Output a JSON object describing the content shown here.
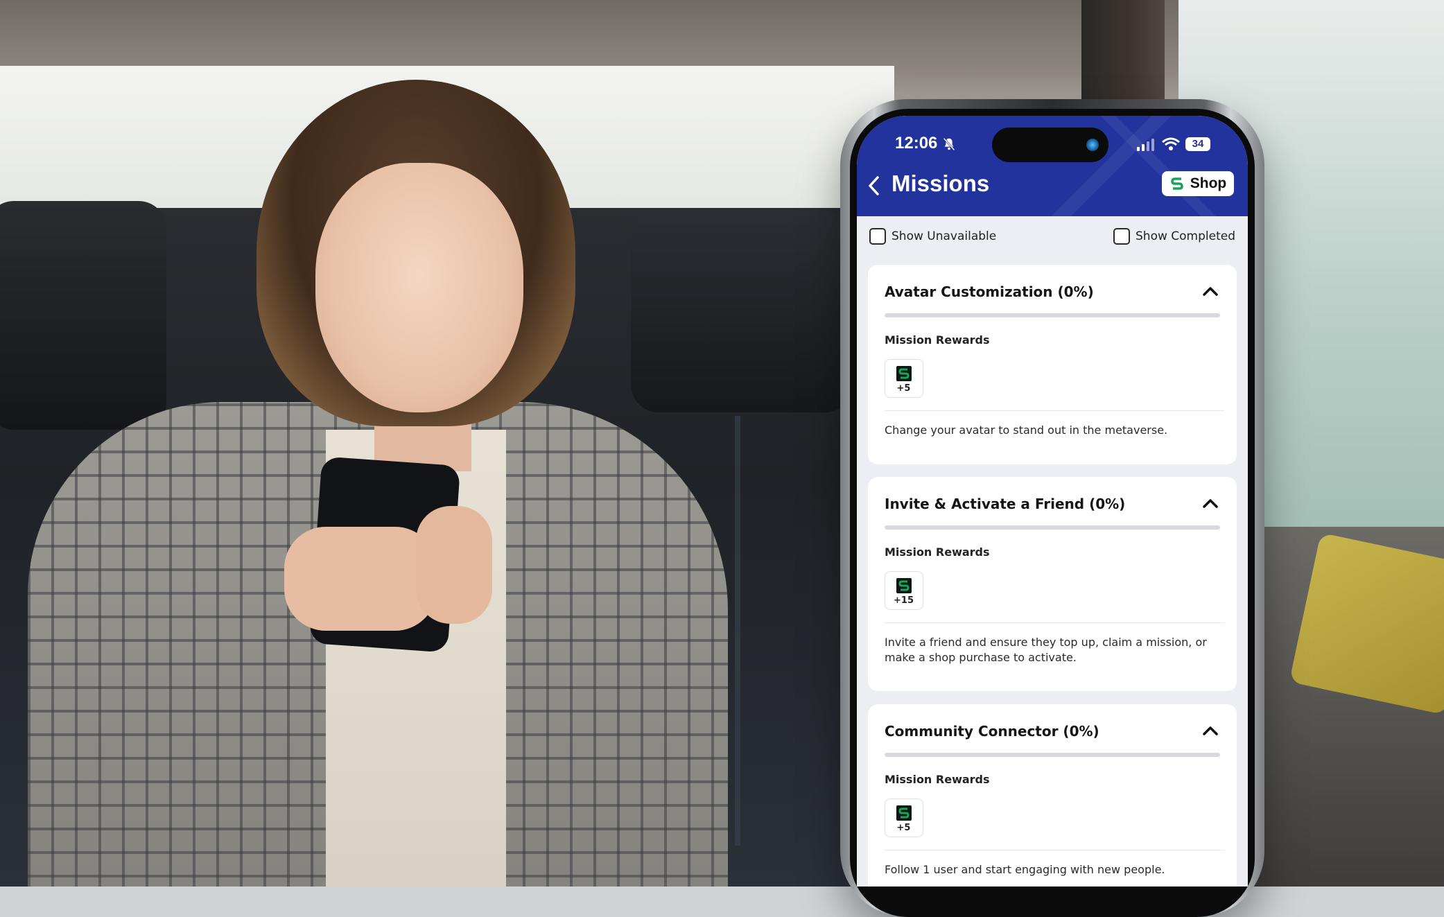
{
  "status_bar": {
    "time": "12:06",
    "battery": "34"
  },
  "header": {
    "title": "Missions",
    "shop_label": "Shop"
  },
  "filters": {
    "show_unavailable": "Show Unavailable",
    "show_completed": "Show Completed"
  },
  "missions": [
    {
      "title": "Avatar Customization (0%)",
      "progress": 0,
      "rewards_label": "Mission Rewards",
      "reward_amount": "+5",
      "description": "Change your avatar to stand out in the metaverse."
    },
    {
      "title": "Invite & Activate a Friend (0%)",
      "progress": 0,
      "rewards_label": "Mission Rewards",
      "reward_amount": "+15",
      "description": "Invite a friend and ensure they top up, claim a mission, or make a shop purchase to activate."
    },
    {
      "title": "Community Connector (0%)",
      "progress": 0,
      "rewards_label": "Mission Rewards",
      "reward_amount": "+5",
      "description": "Follow 1 user and start engaging with new people."
    }
  ],
  "colors": {
    "brand": "#23339d",
    "token_green": "#1aa35a",
    "token_bg": "#0d1a14"
  },
  "icons": [
    "bell-slash-icon",
    "signal-icon",
    "wifi-icon",
    "back-chevron-icon",
    "shop-logo-icon",
    "chevron-up-icon",
    "token-icon"
  ]
}
